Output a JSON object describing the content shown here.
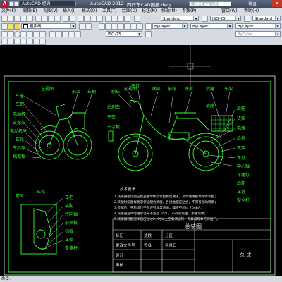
{
  "title_bar": {
    "workspace": "AutoCAD 经典",
    "app": "AutoCAD 2012",
    "file": "四行车CAD图纸.dwg",
    "search_placeholder": "键入关键字或短语",
    "login": "登录"
  },
  "menu": [
    "文件(F)",
    "编辑(E)",
    "视图(V)",
    "插入(I)",
    "格式(O)",
    "工具(T)",
    "绘图(D)",
    "标注(N)",
    "修改(M)",
    "参数(P)",
    "窗口(W)",
    "帮助(H)"
  ],
  "toolbars": {
    "layer_name": "粗实线",
    "layer_prop": "ByLayer",
    "text_style": "Standard",
    "dim_style": "ISO-25",
    "table_style": "Standard",
    "dim_style_2": "ISO-25",
    "color": "ByLayer",
    "linetype": "ByLayer",
    "lineweight": "ByLayer",
    "plot_style": "ByColor"
  },
  "drawing": {
    "view_labels": {
      "left": "左视图",
      "front": "前视图"
    },
    "labels_left": [
      "车座",
      "车把",
      "电动机",
      "支撑架",
      "电动机座",
      "车轮",
      "车后架",
      "挡泥板"
    ],
    "labels_top": [
      "前叉",
      "车把",
      "刹车",
      "车灯",
      "喇叭",
      "前轮",
      "底板",
      "后座",
      "车架",
      "后刹车",
      "车筐",
      "十字板",
      "后座"
    ],
    "labels_right": [
      "后轮",
      "货架",
      "电瓶",
      "后挡",
      "支架",
      "车灯",
      "中心轴",
      "车尾灯",
      "后轮",
      "车链",
      "安全杆"
    ],
    "labels_bottom": [
      "前叉",
      "车轮",
      "车把",
      "装配",
      "转向轴",
      "前挡板",
      "挡板",
      "车锁",
      "支撑杆"
    ],
    "tech_title": "技术要求",
    "tech_lines": [
      "1.减速器齿轮副应检查各零件及装配精度要求，严禁使用损坏零件装配；",
      "2.装配时按图样要求保证配合精度，各接触面应贴合，不得有松动现象；",
      "3.装配后，平稳运行不允许有异常声响，噪声不超过 70dBA；",
      "4.减速器运转时轴承温升不超过 60°C，不得有漏油、渗油现象；",
      "5.减速器装配完毕后应经过2小时以上空载试运转，无异常现象方可出厂。"
    ],
    "title_block": {
      "name": "总装图",
      "drawn": "设计",
      "checked": "审核",
      "total": "总 成",
      "units": [
        "标记",
        "处数",
        "分区",
        "更改文件号",
        "签名",
        "年月日"
      ]
    }
  },
  "status": {
    "text": "命令:"
  }
}
